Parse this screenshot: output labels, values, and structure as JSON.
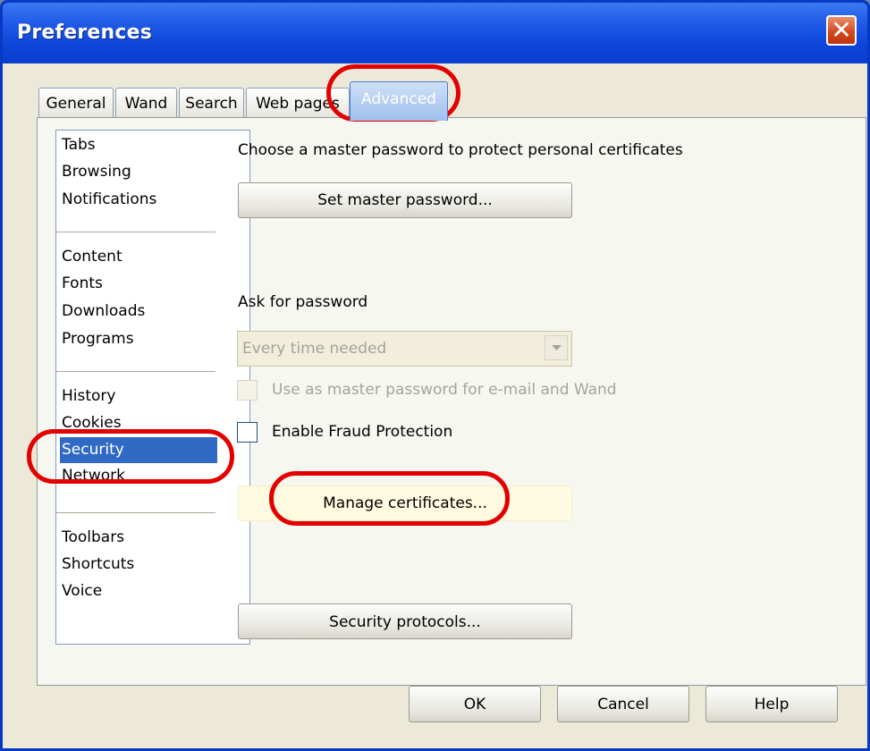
{
  "window": {
    "title": "Preferences"
  },
  "tabs": [
    {
      "label": "General"
    },
    {
      "label": "Wand"
    },
    {
      "label": "Search"
    },
    {
      "label": "Web pages"
    },
    {
      "label": "Advanced"
    }
  ],
  "sidebar": {
    "items": [
      {
        "label": "Tabs"
      },
      {
        "label": "Browsing"
      },
      {
        "label": "Notifications"
      },
      {
        "label": "Content"
      },
      {
        "label": "Fonts"
      },
      {
        "label": "Downloads"
      },
      {
        "label": "Programs"
      },
      {
        "label": "History"
      },
      {
        "label": "Cookies"
      },
      {
        "label": "Security"
      },
      {
        "label": "Network"
      },
      {
        "label": "Toolbars"
      },
      {
        "label": "Shortcuts"
      },
      {
        "label": "Voice"
      }
    ],
    "selected": "Security"
  },
  "security": {
    "master_heading": "Choose a master password to protect personal certificates",
    "set_master_button": "Set master password...",
    "ask_label": "Ask for password",
    "ask_select_value": "Every time needed",
    "use_master_checkbox": "Use as master password for e-mail and Wand",
    "fraud_checkbox": "Enable Fraud Protection",
    "manage_certs_button": "Manage certificates...",
    "protocols_button": "Security protocols..."
  },
  "footer": {
    "ok": "OK",
    "cancel": "Cancel",
    "help": "Help"
  },
  "colors": {
    "annotation": "#e30000",
    "selection": "#316ac5",
    "titlebar": "#0a3fcc"
  }
}
